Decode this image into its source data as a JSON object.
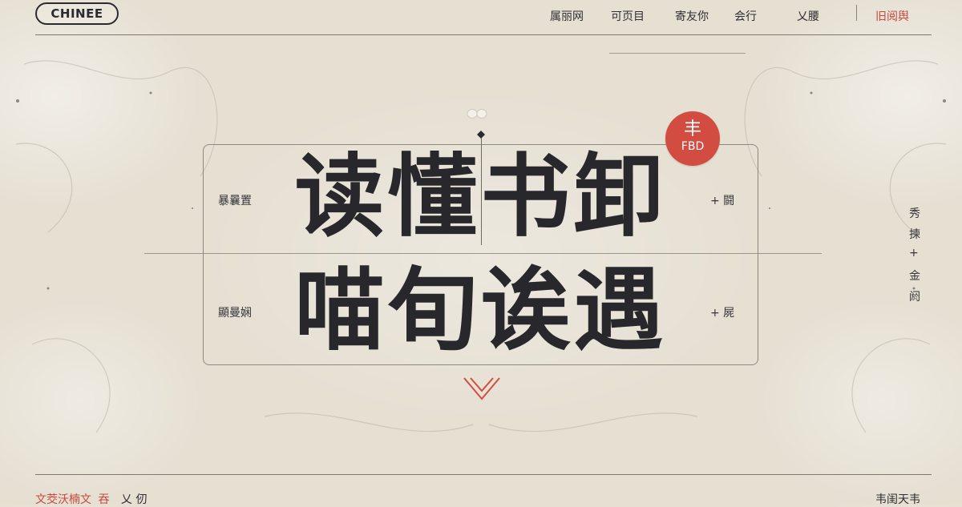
{
  "header": {
    "logo": "CHINEE",
    "nav": [
      "属丽网",
      "可页目",
      "寄友你",
      "会行",
      "乂腰"
    ],
    "cta": "旧阅舆"
  },
  "hero": {
    "line1": "读懂书卸",
    "line2": "喵旬诶遇",
    "badge": {
      "char": "丰",
      "sub": "FBD"
    },
    "left_labels": [
      "暴曩置",
      "顯曼娴"
    ],
    "right_labels": [
      "+ 闘",
      "+ 屍"
    ]
  },
  "right_column": [
    "秀",
    "揀",
    "+",
    "金",
    "阏"
  ],
  "footer": {
    "left_accent": "文茭沃楠文",
    "left_red2": "吞",
    "left_plain": "乂  仞",
    "right": "韦闺天韦"
  },
  "colors": {
    "accent": "#d24c42",
    "text": "#28282c",
    "background": "#e6e0d3"
  }
}
